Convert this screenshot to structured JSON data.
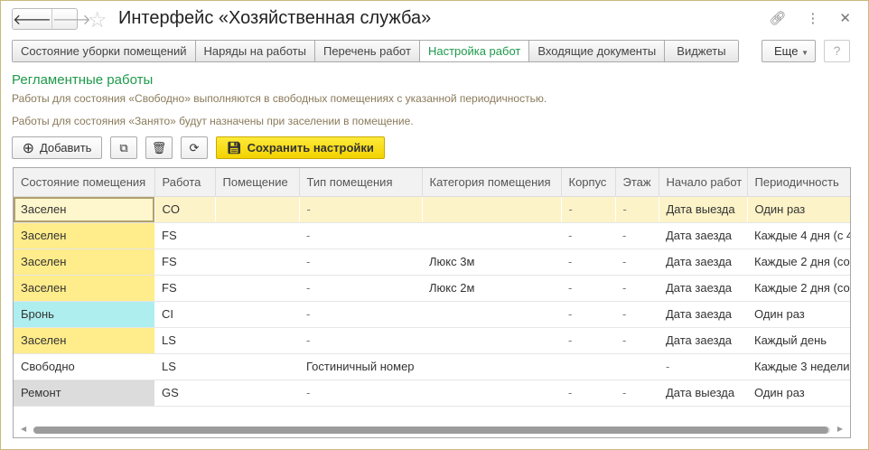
{
  "window": {
    "title": "Интерфейс «Хозяйственная служба»",
    "back": "🡐",
    "forward": "🡒",
    "icons": [
      "link-icon",
      "more-vertical-icon",
      "close-icon"
    ]
  },
  "tabs": [
    {
      "label": "Состояние уборки помещений"
    },
    {
      "label": "Наряды на работы"
    },
    {
      "label": "Перечень работ"
    },
    {
      "label": "Настройка работ",
      "active": true
    },
    {
      "label": "Входящие документы"
    },
    {
      "label": "Виджеты"
    }
  ],
  "more_label": "Еще",
  "help_label": "?",
  "section": {
    "title": "Регламентные работы",
    "info1": "Работы для состояния «Свободно» выполняются в свободных помещениях с указанной периодичностью.",
    "info2": "Работы для состояния «Занято» будут назначены при заселении в помещение."
  },
  "toolbar": {
    "add_label": "Добавить",
    "save_label": "Сохранить настройки"
  },
  "colors": {
    "accent": "#1e9a4b",
    "occupied": "#ffec8b",
    "booked": "#aeeeee",
    "repair": "#dcdcdc",
    "selected_row": "#fdf3c8",
    "save_button": "#f2d200"
  },
  "table": {
    "columns": [
      "Состояние помещения",
      "Работа",
      "Помещение",
      "Тип помещения",
      "Категория помещения",
      "Корпус",
      "Этаж",
      "Начало работ",
      "Периодичность"
    ],
    "rows": [
      [
        "Заселен",
        "CO",
        "",
        "-",
        "",
        "-",
        "-",
        "Дата выезда",
        "Один раз"
      ],
      [
        "Заселен",
        "FS",
        "",
        "-",
        "",
        "-",
        "-",
        "Дата заезда",
        "Каждые 4 дня (с 4"
      ],
      [
        "Заселен",
        "FS",
        "",
        "-",
        "Люкс 3м",
        "-",
        "-",
        "Дата заезда",
        "Каждые 2 дня (со"
      ],
      [
        "Заселен",
        "FS",
        "",
        "-",
        "Люкс 2м",
        "-",
        "-",
        "Дата заезда",
        "Каждые 2 дня (со"
      ],
      [
        "Бронь",
        "CI",
        "",
        "-",
        "",
        "-",
        "-",
        "Дата заезда",
        "Один раз"
      ],
      [
        "Заселен",
        "LS",
        "",
        "-",
        "",
        "-",
        "-",
        "Дата заезда",
        "Каждый день"
      ],
      [
        "Свободно",
        "LS",
        "",
        "Гостиничный номер",
        "",
        "",
        "",
        "-",
        "Каждые 3 недели"
      ],
      [
        "Ремонт",
        "GS",
        "",
        "-",
        "",
        "-",
        "-",
        "Дата выезда",
        "Один раз"
      ]
    ]
  }
}
